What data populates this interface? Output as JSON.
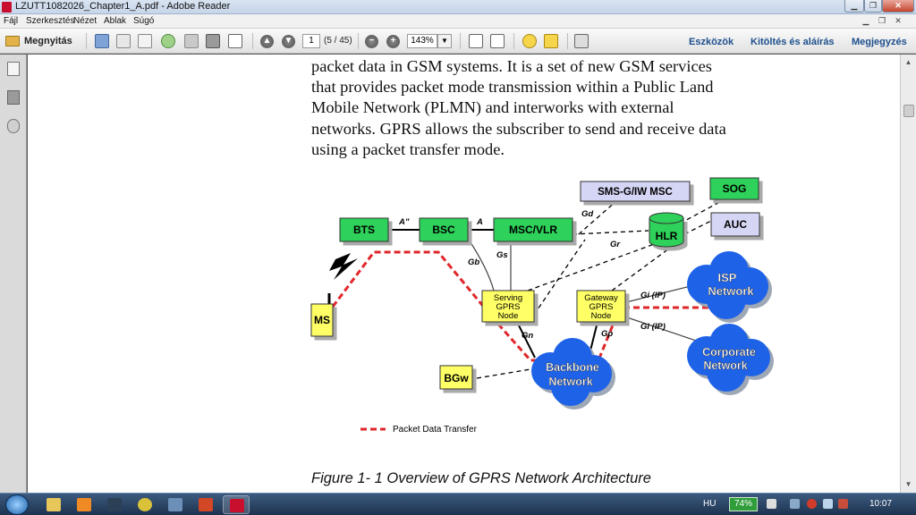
{
  "window": {
    "title": "LZUTT1082026_Chapter1_A.pdf - Adobe Reader"
  },
  "menu": [
    "Fájl",
    "Szerkesztés",
    "Nézet",
    "Ablak",
    "Súgó"
  ],
  "toolbar": {
    "open_label": "Megnyitás",
    "page_value": "1",
    "page_count": "(5 / 45)",
    "zoom_value": "143%",
    "tools_label": "Eszközök",
    "fill_sign_label": "Kitöltés és aláírás",
    "comment_label": "Megjegyzés"
  },
  "document": {
    "body_lines": [
      "packet data in GSM systems. It is a set of new GSM services",
      "that provides packet mode transmission within a Public Land",
      "Mobile Network (PLMN) and interworks with external",
      "networks. GPRS allows the subscriber to send and receive data",
      "using a packet transfer mode."
    ],
    "caption": "Figure 1- 1 Overview of GPRS Network Architecture",
    "diagram": {
      "nodes": {
        "bts": "BTS",
        "bsc": "BSC",
        "msc": "MSC/VLR",
        "smsg": "SMS-G/IW MSC",
        "sog": "SOG",
        "auc": "AUC",
        "hlr": "HLR",
        "ms": "MS",
        "sgsn": [
          "Serving",
          "GPRS",
          "Node"
        ],
        "ggsn": [
          "Gateway",
          "GPRS",
          "Node"
        ],
        "bgw": "BGw"
      },
      "clouds": {
        "isp": [
          "ISP",
          "Network"
        ],
        "corp": [
          "Corporate",
          "Network"
        ],
        "backbone": [
          "Backbone",
          "Network"
        ]
      },
      "interfaces": {
        "abis": "A\"",
        "a": "A",
        "gd": "Gd",
        "gr": "Gr",
        "gb": "Gb",
        "gs": "Gs",
        "gn": "Gn",
        "gp": "Gp",
        "gi1": "Gi (IP)",
        "gi2": "Gi (IP)"
      },
      "legend": "Packet Data Transfer"
    }
  },
  "taskbar": {
    "language": "HU",
    "battery": "74%",
    "clock": "10:07"
  },
  "colors": {
    "node_green": "#2fd15a",
    "node_lavender": "#d5d5f5",
    "node_yellow": "#ffff66",
    "cloud_blue": "#1e62e8",
    "packet_red": "#e0262a"
  }
}
